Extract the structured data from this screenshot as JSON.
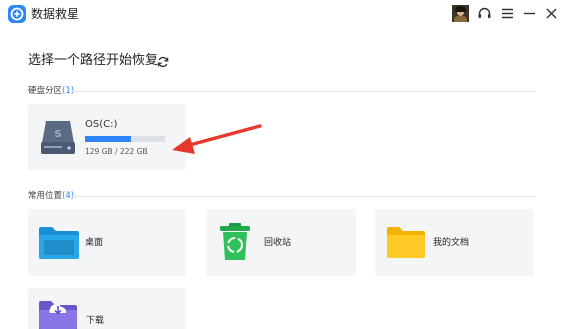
{
  "app": {
    "title": "数据救星"
  },
  "colors": {
    "accent": "#2f86f6",
    "arrow": "#e8382c",
    "card_bg": "#f4f5f7"
  },
  "titlebar_icons": [
    "avatar",
    "headset-icon",
    "menu-icon",
    "minimize-icon",
    "close-icon"
  ],
  "main": {
    "heading": "选择一个路径开始恢复"
  },
  "partitions": {
    "label": "硬盘分区",
    "count": "(1)",
    "drives": [
      {
        "name": "OS(C:)",
        "size": "129 GB / 222 GB",
        "used_fraction": 0.58
      }
    ]
  },
  "common": {
    "label": "常用位置",
    "count": "(4)",
    "items": [
      {
        "label": "桌面",
        "icon": "desktop-folder-icon"
      },
      {
        "label": "回收站",
        "icon": "recycle-bin-icon"
      },
      {
        "label": "我的文档",
        "icon": "documents-folder-icon"
      },
      {
        "label": "下载",
        "icon": "downloads-folder-icon"
      }
    ]
  }
}
